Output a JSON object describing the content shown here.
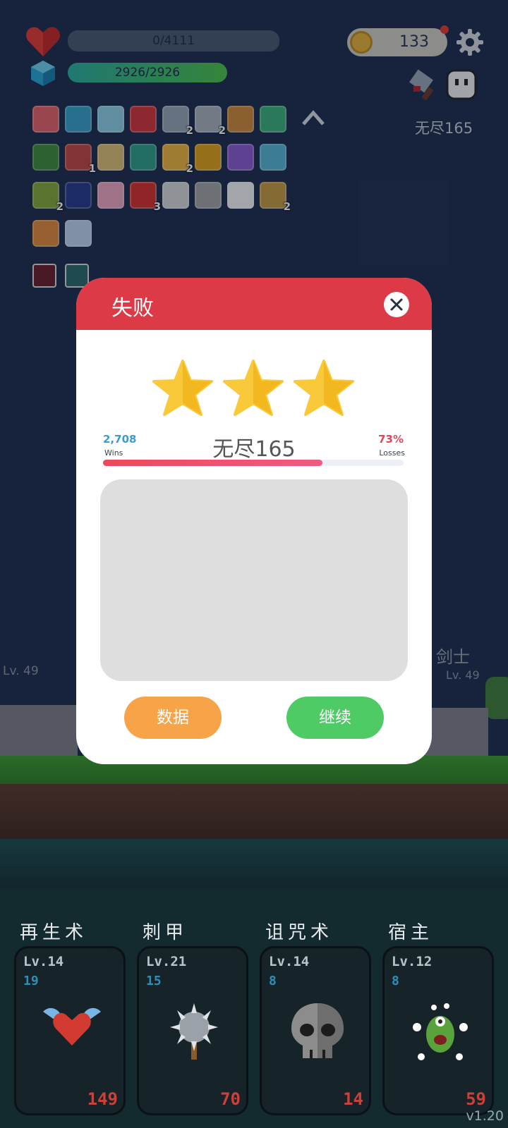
{
  "hud": {
    "hp_text": "0/4111",
    "mana_text": "2926/2926",
    "coins": "133",
    "stage_label": "无尽165"
  },
  "inventory": {
    "items": [
      {
        "icon": "calendar-heart-icon",
        "count": ""
      },
      {
        "icon": "scroll-icon",
        "count": ""
      },
      {
        "icon": "magnifier-icon",
        "count": ""
      },
      {
        "icon": "bookmark-icon",
        "count": ""
      },
      {
        "icon": "dagger-icon",
        "count": "2"
      },
      {
        "icon": "sword-icon",
        "count": "2"
      },
      {
        "icon": "crossbow-icon",
        "count": ""
      },
      {
        "icon": "lamp-icon",
        "count": ""
      },
      {
        "icon": "book-green-icon",
        "count": ""
      },
      {
        "icon": "pill-icon",
        "count": "1"
      },
      {
        "icon": "map-icon",
        "count": ""
      },
      {
        "icon": "tent-icon",
        "count": ""
      },
      {
        "icon": "beer-icon",
        "count": "2"
      },
      {
        "icon": "pineapple-icon",
        "count": ""
      },
      {
        "icon": "chest-icon",
        "count": ""
      },
      {
        "icon": "syringe-icon",
        "count": ""
      },
      {
        "icon": "potion-icon",
        "count": "2"
      },
      {
        "icon": "bible-icon",
        "count": ""
      },
      {
        "icon": "ice-cream-icon",
        "count": ""
      },
      {
        "icon": "apple-icon",
        "count": "3"
      },
      {
        "icon": "cards-icon",
        "count": ""
      },
      {
        "icon": "meteor-icon",
        "count": ""
      },
      {
        "icon": "flower-icon",
        "count": ""
      },
      {
        "icon": "card-book-icon",
        "count": "2"
      },
      {
        "icon": "scroll-orange-icon",
        "count": ""
      },
      {
        "icon": "capsule-icon",
        "count": ""
      }
    ]
  },
  "battle": {
    "lvl_left": "Lv. 49",
    "lvl_right": "Lv. 49",
    "name_right": "剑士"
  },
  "dialog": {
    "title": "失败",
    "stage": "无尽165",
    "wins_value": "2,708",
    "wins_label": "Wins",
    "losses_value": "73%",
    "losses_label": "Losses",
    "loss_fraction": 0.73,
    "stars": 3,
    "stats_button": "数据",
    "continue_button": "继续"
  },
  "skills": [
    {
      "name": "再生术",
      "level": "Lv.14",
      "cost": "19",
      "value": "149",
      "icon": "winged-heart-icon"
    },
    {
      "name": "刺甲",
      "level": "Lv.21",
      "cost": "15",
      "value": "70",
      "icon": "spiked-mace-icon"
    },
    {
      "name": "诅咒术",
      "level": "Lv.14",
      "cost": "8",
      "value": "14",
      "icon": "skull-icon"
    },
    {
      "name": "宿主",
      "level": "Lv.12",
      "cost": "8",
      "value": "59",
      "icon": "green-monster-icon"
    }
  ],
  "version": "v1.20",
  "colors": {
    "background": "#1f2d4d",
    "dialog_header": "#dd3a48",
    "stats_button": "#f7a348",
    "continue_button": "#4fcb65",
    "star": "#f9c93a",
    "wins": "#3a9bd5",
    "losses": "#e0455a"
  }
}
